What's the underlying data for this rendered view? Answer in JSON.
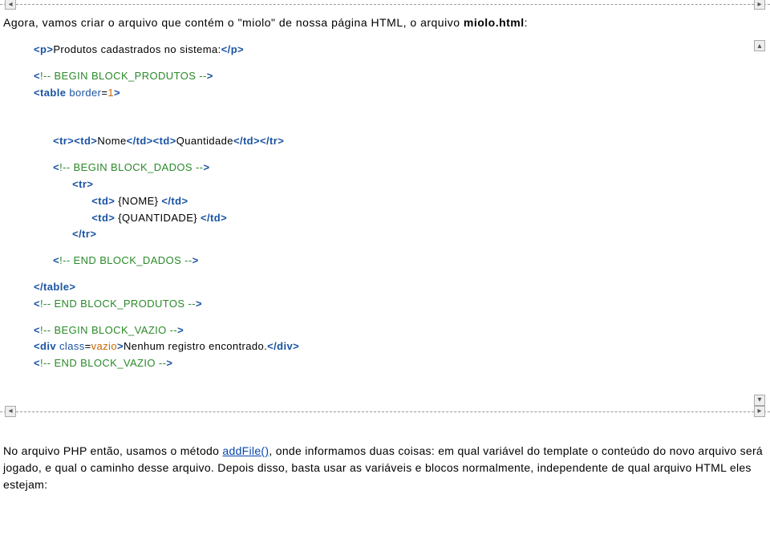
{
  "intro": {
    "prefix": "Agora, vamos criar o arquivo que contém o \"miolo\" de nossa página HTML, o arquivo ",
    "filename": "miolo.html",
    "suffix": ":"
  },
  "code": {
    "l1a": "<p>",
    "l1b": "Produtos cadastrados no sistema:",
    "l1c": "</p>",
    "l2a": "<",
    "l2b": "!-- BEGIN BLOCK_PRODUTOS --",
    "l2c": ">",
    "l3a": "<table ",
    "l3b": "border",
    "l3c": "=",
    "l3d": "1",
    "l3e": ">",
    "l4a": "<tr><td>",
    "l4b": "Nome",
    "l4c": "</td><td>",
    "l4d": "Quantidade",
    "l4e": "</td></tr>",
    "l5a": "<",
    "l5b": "!-- BEGIN BLOCK_DADOS --",
    "l5c": ">",
    "l6": "<tr>",
    "l7a": "<td>",
    "l7b": " {NOME} ",
    "l7c": "</td>",
    "l8a": "<td>",
    "l8b": " {QUANTIDADE} ",
    "l8c": "</td>",
    "l9": "</tr>",
    "l10a": "<",
    "l10b": "!-- END BLOCK_DADOS --",
    "l10c": ">",
    "l11": "</table>",
    "l12a": "<",
    "l12b": "!-- END BLOCK_PRODUTOS --",
    "l12c": ">",
    "l13a": "<",
    "l13b": "!-- BEGIN BLOCK_VAZIO --",
    "l13c": ">",
    "l14a": "<div ",
    "l14b": "class",
    "l14c": "=",
    "l14d": "vazio",
    "l14e": ">",
    "l14f": "Nenhum registro encontrado.",
    "l14g": "</div>",
    "l15a": "<",
    "l15b": "!-- END BLOCK_VAZIO --",
    "l15c": ">"
  },
  "explain": {
    "p1a": "No arquivo PHP então, usamos o método ",
    "p1link": "addFile()",
    "p1b": ", onde informamos duas coisas: em qual variável do template o conteúdo do novo arquivo será jogado, e qual o caminho desse arquivo. Depois disso, basta usar as variáveis e blocos normalmente, independente de qual arquivo HTML eles estejam:"
  },
  "icons": {
    "up": "▴",
    "down": "▾",
    "left": "◂",
    "right": "▸"
  }
}
